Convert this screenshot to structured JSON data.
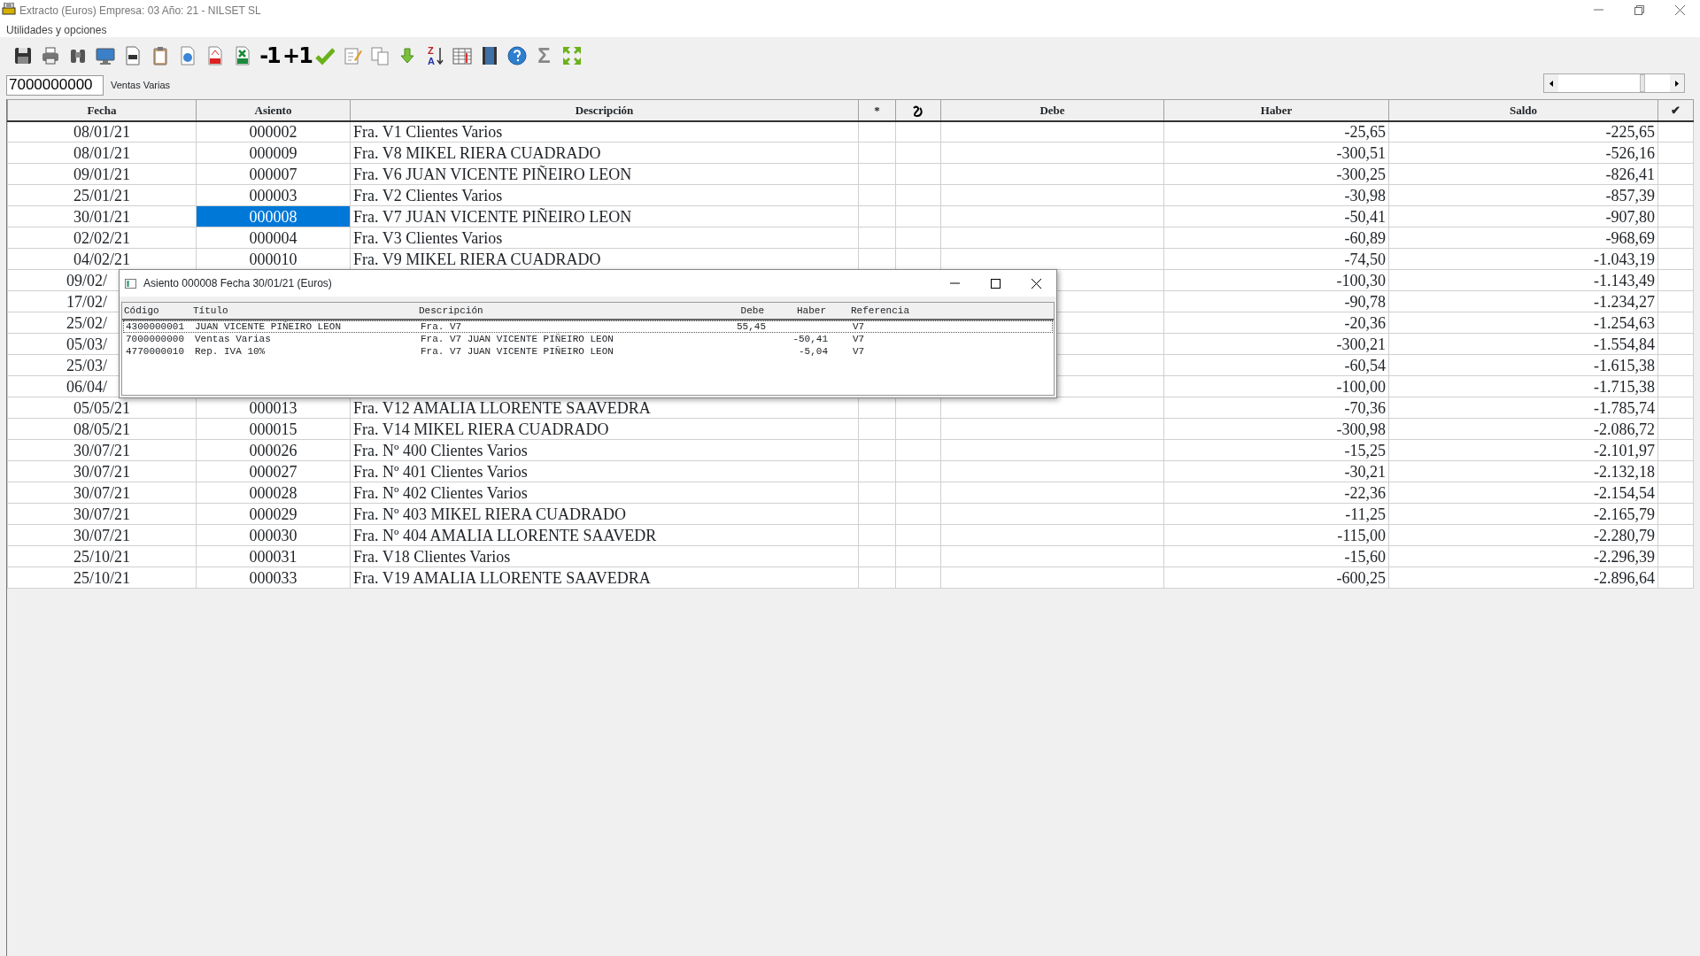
{
  "window": {
    "title": "Extracto (Euros) Empresa: 03  Año: 21 - NILSET SL"
  },
  "menu": [
    "Utilidades y opciones"
  ],
  "toolbar": [
    {
      "kind": "icon"
    },
    {
      "kind": "icon"
    },
    {
      "kind": "icon"
    },
    {
      "kind": "icon"
    },
    {
      "kind": "icon"
    },
    {
      "kind": "icon"
    },
    {
      "kind": "icon"
    },
    {
      "kind": "icon"
    },
    {
      "kind": "icon"
    },
    {
      "kind": "text",
      "label": "-1"
    },
    {
      "kind": "text",
      "label": "+1"
    },
    {
      "kind": "icon"
    },
    {
      "kind": "icon"
    },
    {
      "kind": "icon"
    },
    {
      "kind": "icon"
    },
    {
      "kind": "sort",
      "top": "Z",
      "bottom": "A"
    },
    {
      "kind": "icon"
    },
    {
      "kind": "icon"
    },
    {
      "kind": "icon"
    },
    {
      "kind": "text",
      "label": "Σ"
    },
    {
      "kind": "icon"
    }
  ],
  "account": {
    "value": "7000000000",
    "name": "Ventas Varias"
  },
  "table": {
    "columns": [
      {
        "kind": "text",
        "label": "Fecha"
      },
      {
        "kind": "text",
        "label": "Asiento"
      },
      {
        "kind": "text",
        "label": "Descripción"
      },
      {
        "kind": "text",
        "label": "*"
      },
      {
        "kind": "icon"
      },
      {
        "kind": "text",
        "label": "Debe"
      },
      {
        "kind": "text",
        "label": "Haber"
      },
      {
        "kind": "text",
        "label": "Saldo"
      },
      {
        "kind": "text",
        "label": "✔"
      }
    ],
    "rows": [
      {
        "fecha": "08/01/21",
        "asiento": "000002",
        "descripcion": "Fra.  V1 Clientes Varios",
        "haber": "-25,65",
        "saldo": "-225,65",
        "selected": false
      },
      {
        "fecha": "08/01/21",
        "asiento": "000009",
        "descripcion": "Fra.  V8 MIKEL RIERA CUADRADO",
        "haber": "-300,51",
        "saldo": "-526,16",
        "selected": false
      },
      {
        "fecha": "09/01/21",
        "asiento": "000007",
        "descripcion": "Fra.  V6 JUAN VICENTE PIÑEIRO LEON",
        "haber": "-300,25",
        "saldo": "-826,41",
        "selected": false
      },
      {
        "fecha": "25/01/21",
        "asiento": "000003",
        "descripcion": "Fra.  V2 Clientes Varios",
        "haber": "-30,98",
        "saldo": "-857,39",
        "selected": false
      },
      {
        "fecha": "30/01/21",
        "asiento": "000008",
        "descripcion": "Fra.  V7 JUAN VICENTE PIÑEIRO LEON",
        "haber": "-50,41",
        "saldo": "-907,80",
        "selected": true
      },
      {
        "fecha": "02/02/21",
        "asiento": "000004",
        "descripcion": "Fra.  V3 Clientes Varios",
        "haber": "-60,89",
        "saldo": "-968,69",
        "selected": false
      },
      {
        "fecha": "04/02/21",
        "asiento": "000010",
        "descripcion": "Fra.  V9 MIKEL RIERA CUADRADO",
        "haber": "-74,50",
        "saldo": "-1.043,19",
        "selected": false
      },
      {
        "fecha": "09/02/",
        "haber": "-100,30",
        "saldo": "-1.143,49"
      },
      {
        "fecha": "17/02/",
        "haber": "-90,78",
        "saldo": "-1.234,27"
      },
      {
        "fecha": "25/02/",
        "haber": "-20,36",
        "saldo": "-1.254,63"
      },
      {
        "fecha": "05/03/",
        "haber": "-300,21",
        "saldo": "-1.554,84"
      },
      {
        "fecha": "25/03/",
        "haber": "-60,54",
        "saldo": "-1.615,38"
      },
      {
        "fecha": "06/04/",
        "haber": "-100,00",
        "saldo": "-1.715,38"
      },
      {
        "fecha": "05/05/21",
        "asiento": "000013",
        "descripcion": "Fra.  V12 AMALIA LLORENTE SAAVEDRA",
        "haber": "-70,36",
        "saldo": "-1.785,74",
        "selected": false
      },
      {
        "fecha": "08/05/21",
        "asiento": "000015",
        "descripcion": "Fra.  V14 MIKEL RIERA CUADRADO",
        "haber": "-300,98",
        "saldo": "-2.086,72",
        "selected": false
      },
      {
        "fecha": "30/07/21",
        "asiento": "000026",
        "descripcion": "Fra. Nº 400 Clientes Varios",
        "haber": "-15,25",
        "saldo": "-2.101,97",
        "selected": false
      },
      {
        "fecha": "30/07/21",
        "asiento": "000027",
        "descripcion": "Fra. Nº 401 Clientes Varios",
        "haber": "-30,21",
        "saldo": "-2.132,18",
        "selected": false
      },
      {
        "fecha": "30/07/21",
        "asiento": "000028",
        "descripcion": "Fra. Nº 402 Clientes Varios",
        "haber": "-22,36",
        "saldo": "-2.154,54",
        "selected": false
      },
      {
        "fecha": "30/07/21",
        "asiento": "000029",
        "descripcion": "Fra. Nº 403 MIKEL RIERA CUADRADO",
        "haber": "-11,25",
        "saldo": "-2.165,79",
        "selected": false
      },
      {
        "fecha": "30/07/21",
        "asiento": "000030",
        "descripcion": "Fra. Nº 404 AMALIA LLORENTE SAAVEDR",
        "haber": "-115,00",
        "saldo": "-2.280,79",
        "selected": false
      },
      {
        "fecha": "25/10/21",
        "asiento": "000031",
        "descripcion": "Fra.  V18 Clientes Varios",
        "haber": "-15,60",
        "saldo": "-2.296,39",
        "selected": false
      },
      {
        "fecha": "25/10/21",
        "asiento": "000033",
        "descripcion": "Fra.  V19 AMALIA LLORENTE SAAVEDRA",
        "haber": "-600,25",
        "saldo": "-2.896,64",
        "selected": false
      }
    ]
  },
  "popup": {
    "title": "Asiento 000008    Fecha 30/01/21 (Euros)",
    "columns": [
      "Código",
      "Título",
      "Descripción",
      "Debe",
      "Haber",
      "Referencia"
    ],
    "entries": [
      {
        "codigo": "4300000001",
        "titulo": "JUAN VICENTE PIÑEIRO LEON",
        "descripcion": "Fra.  V7",
        "debe": "55,45",
        "referencia": "V7",
        "focused": true
      },
      {
        "codigo": "7000000000",
        "titulo": "Ventas Varias",
        "descripcion": "Fra.  V7 JUAN VICENTE PIÑEIRO LEON",
        "haber": "-50,41",
        "referencia": "V7",
        "focused": false
      },
      {
        "codigo": "4770000010",
        "titulo": "Rep. IVA 10%",
        "descripcion": "Fra.  V7 JUAN VICENTE PIÑEIRO LEON",
        "haber": "-5,04",
        "referencia": "V7",
        "focused": false
      }
    ]
  }
}
